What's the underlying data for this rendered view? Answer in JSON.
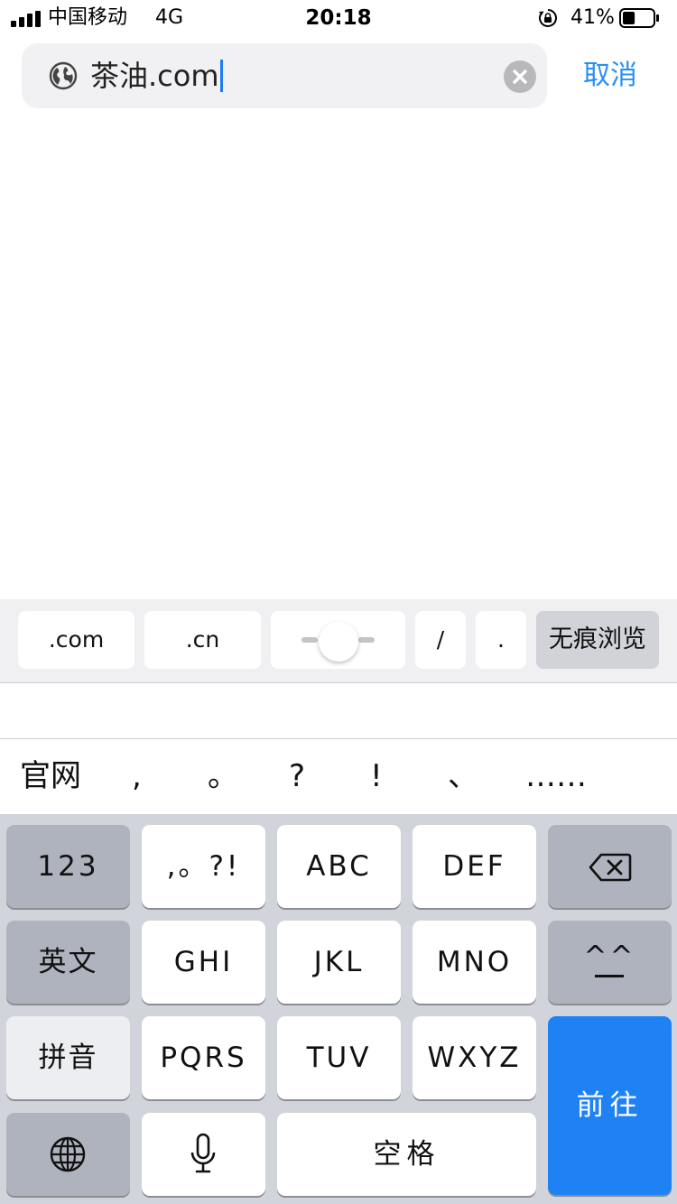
{
  "status_bar": {
    "carrier": "中国移动",
    "network": "4G",
    "time": "20:18",
    "battery_percent": "41%",
    "battery_level": 0.41
  },
  "address_bar": {
    "url_value": "茶油.com",
    "cancel_label": "取消"
  },
  "shortcuts": {
    "com": ".com",
    "cn": ".cn",
    "slash": "/",
    "dot": ".",
    "private_browsing": "无痕浏览"
  },
  "candidates": {
    "word": "官网",
    "punct": [
      ",",
      "。",
      "?",
      "!",
      "、",
      "……"
    ]
  },
  "keyboard": {
    "num": "123",
    "punct": ",。?!",
    "abc": "ABC",
    "def": "DEF",
    "english": "英文",
    "ghi": "GHI",
    "jkl": "JKL",
    "mno": "MNO",
    "emoji": "^^",
    "pinyin": "拼音",
    "pqrs": "PQRS",
    "tuv": "TUV",
    "wxyz": "WXYZ",
    "space": "空格",
    "go": "前往"
  },
  "colors": {
    "accent": "#2a8ff5",
    "go_key": "#1e82f5",
    "keyboard_bg": "#d1d4db"
  }
}
